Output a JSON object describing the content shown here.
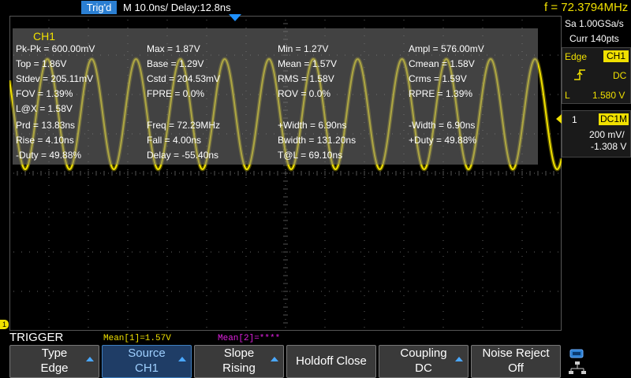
{
  "topbar": {
    "trigger_status": "Trig'd",
    "timebase": "M 10.0ns/  Delay:12.8ns",
    "frequency": "f = 72.3794MHz"
  },
  "right_panel": {
    "sample_rate": "Sa 1.00GSa/s",
    "memory": "Curr 140pts",
    "trigger_type": "Edge",
    "trigger_source": "CH1",
    "slope_icon": "rising-edge-icon",
    "coupling": "DC",
    "level_label": "L",
    "level_value": "1.580 V",
    "channel_number": "1",
    "channel_coupling": "DC1M",
    "volts_per_div": "200 mV/",
    "offset": "-1.308 V"
  },
  "measurements": {
    "title": "CH1",
    "items": [
      "Pk-Pk = 600.00mV",
      "Max = 1.87V",
      "Min = 1.27V",
      "Ampl = 576.00mV",
      "Top = 1.86V",
      "Base = 1.29V",
      "Mean = 1.57V",
      "Cmean = 1.58V",
      "Stdev = 205.11mV",
      "Cstd = 204.53mV",
      "RMS = 1.58V",
      "Crms = 1.59V",
      "FOV = 1.39%",
      "FPRE = 0.0%",
      "ROV = 0.0%",
      "RPRE = 1.39%",
      "L@X = 1.58V",
      "Prd = 13.83ns",
      "Freq = 72.29MHz",
      "+Width = 6.90ns",
      "-Width = 6.90ns",
      "Rise = 4.10ns",
      "Fall = 4.00ns",
      "Bwidth = 131.20ns",
      "+Duty = 49.88%",
      "-Duty = 49.88%",
      "Delay = -55.40ns",
      "T@L = 69.10ns"
    ]
  },
  "status_line": {
    "trigger_menu_title": "TRIGGER",
    "mean1": "Mean[1]=1.57V",
    "mean2": "Mean[2]=****"
  },
  "softkeys": [
    {
      "line1": "Type",
      "line2": "Edge"
    },
    {
      "line1": "Source",
      "line2": "CH1"
    },
    {
      "line1": "Slope",
      "line2": "Rising"
    },
    {
      "line1": "Holdoff Close",
      "line2": ""
    },
    {
      "line1": "Coupling",
      "line2": "DC"
    },
    {
      "line1": "Noise Reject",
      "line2": "Off"
    }
  ],
  "colors": {
    "ch1": "#f0e000",
    "accent_blue": "#2b7fd2",
    "ch2": "#e020e0"
  },
  "icons": {
    "usb": "usb-icon",
    "network": "network-icon",
    "channel_marker": "channel-1-ground-marker-icon",
    "trigger_position": "trigger-position-marker-icon"
  }
}
